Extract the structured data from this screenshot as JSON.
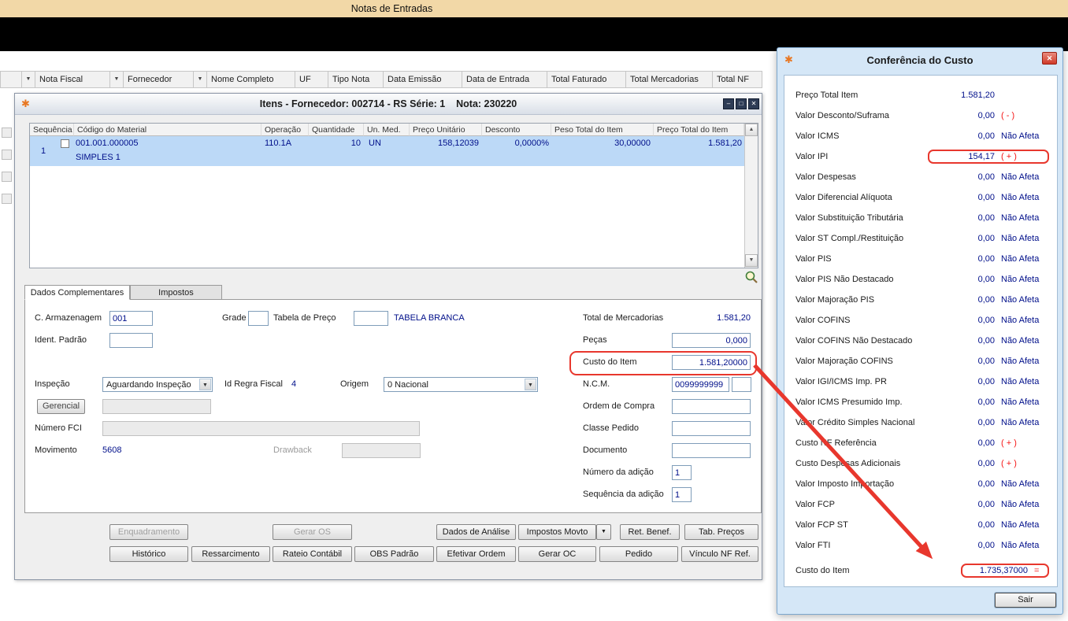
{
  "colors": {
    "accent_navy": "#000f8a",
    "highlight_red": "#e8372d",
    "selection_blue": "#bcd9f7",
    "titlebar_tan": "#f2d8a7"
  },
  "icons": {
    "logo": "✱",
    "minimize": "–",
    "maximize": "□",
    "close": "✕",
    "dropdown_arrow": "▼",
    "scroll_up": "▲",
    "scroll_down": "▼"
  },
  "app": {
    "title": "Notas de Entradas"
  },
  "browse_header": {
    "columns": [
      "Nota Fiscal",
      "Fornecedor",
      "Nome Completo",
      "UF",
      "Tipo Nota",
      "Data Emissão",
      "Data de Entrada",
      "Total Faturado",
      "Total Mercadorias",
      "Total NF"
    ]
  },
  "items_window": {
    "title": "Itens - Fornecedor: 002714 - RS Série: 1    Nota: 230220",
    "grid": {
      "columns": [
        "Sequência",
        "Código do Material",
        "Operação",
        "Quantidade",
        "Un. Med.",
        "Preço Unitário",
        "Desconto",
        "Peso Total do Item",
        "Preço Total do Item"
      ],
      "row": {
        "sequencia": "1",
        "codigo": "001.001.000005",
        "descricao": "SIMPLES 1",
        "operacao": "110.1A",
        "quantidade": "10",
        "un_med": "UN",
        "preco_unitario": "158,12039",
        "desconto": "0,0000%",
        "peso_total": "30,00000",
        "preco_total": "1.581,20"
      }
    },
    "tabs": {
      "dados_complementares": "Dados Complementares",
      "impostos": "Impostos"
    },
    "form": {
      "c_armazenagem_label": "C. Armazenagem",
      "c_armazenagem_value": "001",
      "grade_label": "Grade",
      "tabela_preco_label": "Tabela de Preço",
      "tabela_preco_nome": "TABELA BRANCA",
      "ident_padrao_label": "Ident. Padrão",
      "total_mercadorias_label": "Total de Mercadorias",
      "total_mercadorias_value": "1.581,20",
      "pecas_label": "Peças",
      "pecas_value": "0,000",
      "custo_item_label": "Custo do Item",
      "custo_item_value": "1.581,20000",
      "inspecao_label": "Inspeção",
      "inspecao_value": "Aguardando Inspeção",
      "id_regra_fiscal_label": "Id Regra Fiscal",
      "id_regra_fiscal_value": "4",
      "origem_label": "Origem",
      "origem_value": "0 Nacional",
      "ncm_label": "N.C.M.",
      "ncm_value": "0099999999",
      "gerencial_label": "Gerencial",
      "ordem_compra_label": "Ordem de Compra",
      "numero_fci_label": "Número FCI",
      "classe_pedido_label": "Classe Pedido",
      "movimento_label": "Movimento",
      "movimento_value": "5608",
      "drawback_label": "Drawback",
      "documento_label": "Documento",
      "numero_adicao_label": "Número da adição",
      "numero_adicao_value": "1",
      "sequencia_adicao_label": "Sequência da adição",
      "sequencia_adicao_value": "1"
    },
    "buttons": {
      "enquadramento": "Enquadramento",
      "gerar_os": "Gerar OS",
      "dados_analise": "Dados de Análise",
      "impostos_movto": "Impostos Movto",
      "ret_benef": "Ret. Benef.",
      "tab_precos": "Tab. Preços",
      "historico": "Histórico",
      "ressarcimento": "Ressarcimento",
      "rateio_contabil": "Rateio Contábil",
      "obs_padrao": "OBS Padrão",
      "efetivar_ordem": "Efetivar Ordem",
      "gerar_oc": "Gerar OC",
      "pedido": "Pedido",
      "vinculo_nf_ref": "Vínculo NF Ref."
    }
  },
  "cost_panel": {
    "title": "Conferência do Custo",
    "rows": [
      {
        "label": "Preço Total Item",
        "value": "1.581,20",
        "suffix": ""
      },
      {
        "label": "Valor Desconto/Suframa",
        "value": "0,00",
        "suffix": "( - )"
      },
      {
        "label": "Valor ICMS",
        "value": "0,00",
        "suffix": "Não Afeta"
      },
      {
        "label": "Valor IPI",
        "value": "154,17",
        "suffix": "( + )",
        "highlight": true
      },
      {
        "label": "Valor Despesas",
        "value": "0,00",
        "suffix": "Não Afeta"
      },
      {
        "label": "Valor Diferencial Alíquota",
        "value": "0,00",
        "suffix": "Não Afeta"
      },
      {
        "label": "Valor Substituição Tributária",
        "value": "0,00",
        "suffix": "Não Afeta"
      },
      {
        "label": "Valor ST Compl./Restituição",
        "value": "0,00",
        "suffix": "Não Afeta"
      },
      {
        "label": "Valor PIS",
        "value": "0,00",
        "suffix": "Não Afeta"
      },
      {
        "label": "Valor PIS Não Destacado",
        "value": "0,00",
        "suffix": "Não Afeta"
      },
      {
        "label": "Valor Majoração PIS",
        "value": "0,00",
        "suffix": "Não Afeta"
      },
      {
        "label": "Valor COFINS",
        "value": "0,00",
        "suffix": "Não Afeta"
      },
      {
        "label": "Valor COFINS Não Destacado",
        "value": "0,00",
        "suffix": "Não Afeta"
      },
      {
        "label": "Valor Majoração COFINS",
        "value": "0,00",
        "suffix": "Não Afeta"
      },
      {
        "label": "Valor IGI/ICMS Imp. PR",
        "value": "0,00",
        "suffix": "Não Afeta"
      },
      {
        "label": "Valor ICMS Presumido Imp.",
        "value": "0,00",
        "suffix": "Não Afeta"
      },
      {
        "label": "Valor Crédito Simples Nacional",
        "value": "0,00",
        "suffix": "Não Afeta"
      },
      {
        "label": "Custo NF Referência",
        "value": "0,00",
        "suffix": "( + )"
      },
      {
        "label": "Custo Despesas Adicionais",
        "value": "0,00",
        "suffix": "( + )"
      },
      {
        "label": "Valor Imposto Importação",
        "value": "0,00",
        "suffix": "Não Afeta"
      },
      {
        "label": "Valor FCP",
        "value": "0,00",
        "suffix": "Não Afeta"
      },
      {
        "label": "Valor FCP ST",
        "value": "0,00",
        "suffix": "Não Afeta"
      },
      {
        "label": "Valor FTI",
        "value": "0,00",
        "suffix": "Não Afeta"
      }
    ],
    "total": {
      "label": "Custo do Item",
      "value": "1.735,37000",
      "suffix": "="
    },
    "sair_label": "Sair"
  }
}
